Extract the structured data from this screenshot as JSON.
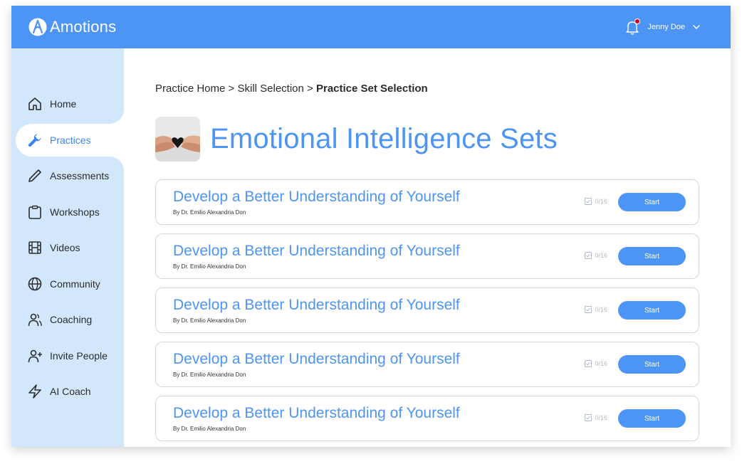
{
  "app": {
    "brand_name": "Amotions"
  },
  "header": {
    "user_name": "Jenny Doe"
  },
  "sidebar": {
    "items": [
      {
        "label": "Home",
        "icon": "home-icon"
      },
      {
        "label": "Practices",
        "icon": "wrench-icon",
        "active": true
      },
      {
        "label": "Assessments",
        "icon": "pencil-icon"
      },
      {
        "label": "Workshops",
        "icon": "clipboard-icon"
      },
      {
        "label": "Videos",
        "icon": "film-icon"
      },
      {
        "label": "Community",
        "icon": "globe-icon"
      },
      {
        "label": "Coaching",
        "icon": "users-icon"
      },
      {
        "label": "Invite People",
        "icon": "user-plus-icon"
      },
      {
        "label": "AI Coach",
        "icon": "lightning-icon"
      }
    ]
  },
  "breadcrumb": {
    "part1": "Practice Home",
    "sep1": " > ",
    "part2": "Skill Selection",
    "sep2": " > ",
    "current": "Practice Set Selection"
  },
  "page": {
    "title": "Emotional Intelligence Sets"
  },
  "sets": [
    {
      "title": "Develop a Better Understanding of Yourself",
      "author": "By Dr. Emilio Alexandria Don",
      "progress": "0/16",
      "button": "Start"
    },
    {
      "title": "Develop a Better Understanding of Yourself",
      "author": "By Dr. Emilio Alexandria Don",
      "progress": "0/16",
      "button": "Start"
    },
    {
      "title": "Develop a Better Understanding of Yourself",
      "author": "By Dr. Emilio Alexandria Don",
      "progress": "0/16",
      "button": "Start"
    },
    {
      "title": "Develop a Better Understanding of Yourself",
      "author": "By Dr. Emilio Alexandria Don",
      "progress": "0/16",
      "button": "Start"
    },
    {
      "title": "Develop a Better Understanding of Yourself",
      "author": "By Dr. Emilio Alexandria Don",
      "progress": "0/16",
      "button": "Start"
    }
  ],
  "colors": {
    "accent": "#4d95f5",
    "sidebar_bg": "#d2e6fc",
    "notification_dot": "#d0021b"
  }
}
